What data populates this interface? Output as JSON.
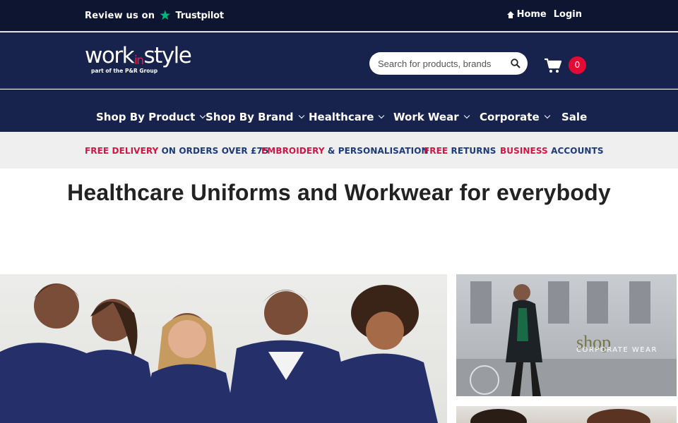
{
  "topbar": {
    "review_prefix": "Review us on",
    "review_brand": "Trustpilot",
    "links": [
      {
        "label": "Home",
        "icon": "home-icon"
      },
      {
        "label": "Login"
      }
    ]
  },
  "header": {
    "logo_text_a": "work",
    "logo_text_in": "in",
    "logo_text_b": "style",
    "logo_sub": "part of the P&R Group",
    "search_placeholder": "Search for products, brands",
    "cart_count": "0"
  },
  "nav": {
    "items": [
      {
        "label": "Shop By Product",
        "has_dropdown": true
      },
      {
        "label": "Shop By Brand",
        "has_dropdown": true
      },
      {
        "label": "Healthcare",
        "has_dropdown": true
      },
      {
        "label": "Work Wear",
        "has_dropdown": true
      },
      {
        "label": "Corporate",
        "has_dropdown": true
      },
      {
        "label": "Sale",
        "has_dropdown": false
      }
    ]
  },
  "usp": {
    "items": [
      {
        "red": "FREE DELIVERY",
        "blue": " ON ORDERS OVER £75"
      },
      {
        "red": "EMBROIDERY",
        "blue": " & PERSONALISATION"
      },
      {
        "red": "FREE",
        "blue": " RETURNS"
      },
      {
        "red": "BUSINESS",
        "blue": " ACCOUNTS"
      }
    ]
  },
  "hero": {
    "title": "Healthcare Uniforms and Workwear for everybody"
  },
  "promo": {
    "side_title": "shop",
    "side_subtitle": "CORPORATE WEAR"
  },
  "colors": {
    "topbar_bg": "#0e1530",
    "header_bg": "#18234d",
    "accent_red": "#d11646",
    "accent_blue": "#1d3a79",
    "trustpilot_green": "#00b67a",
    "cart_badge": "#e30a34"
  }
}
